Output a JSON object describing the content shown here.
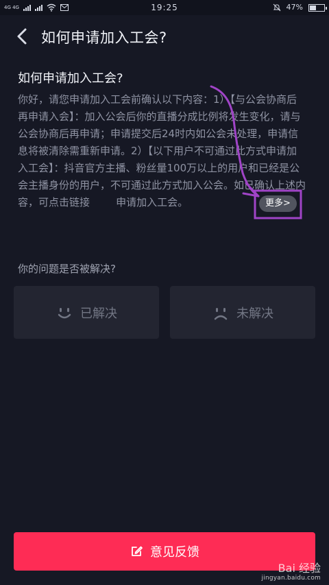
{
  "status_bar": {
    "network_label": "4G 4G",
    "time": "19:25",
    "battery_text": "47%",
    "battery_level": 0.47
  },
  "header": {
    "title": "如何申请加入工会?"
  },
  "article": {
    "title": "如何申请加入工会?",
    "body": "你好，请您申请加入工会前确认以下内容：1）【与公会协商后再申请入会】：加入公会后你的直播分成比例将发生变化，请与公会协商后再申请；申请提交后24时内如公会未处理，申请信息将被清除需重新申请。2）【以下用户不可通过此方式申请加入工会】：抖音官方主播、粉丝量100万以上的用户和已经是公会主播身份的用户，不可通过此方式加入公会。如已确认上述内容，可点击链接        申请加入工会。",
    "more_label": "更多>"
  },
  "question": {
    "label": "你的问题是否被解决?",
    "solved_label": "已解决",
    "unsolved_label": "未解决"
  },
  "feedback": {
    "label": "意见反馈"
  },
  "watermark": {
    "brand": "Bai 经验",
    "url": "jingyan.baidu.com"
  },
  "colors": {
    "background": "#161824",
    "accent": "#fe2c55",
    "annotation": "#a044c7"
  }
}
